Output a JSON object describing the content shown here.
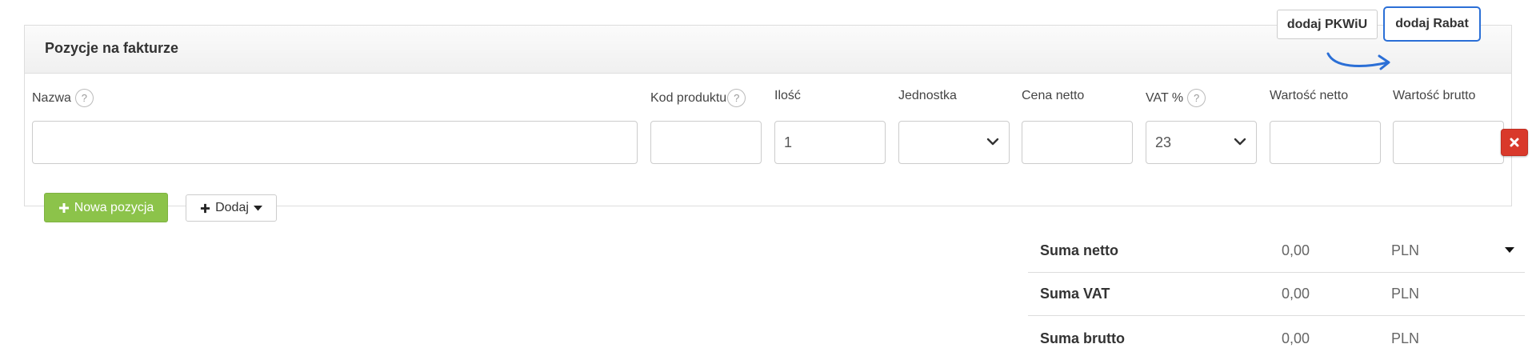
{
  "panel": {
    "title": "Pozycje na fakturze",
    "buttons": {
      "pkwiu": "dodaj PKWiU",
      "rabat": "dodaj Rabat"
    }
  },
  "columns": {
    "nazwa": "Nazwa",
    "kod": "Kod produktu",
    "ilosc": "Ilość",
    "jednostka": "Jednostka",
    "cena_netto": "Cena netto",
    "vat": "VAT %",
    "wartosc_netto": "Wartość netto",
    "wartosc_brutto": "Wartość brutto"
  },
  "help_glyph": "?",
  "row": {
    "nazwa": "",
    "kod": "",
    "ilosc": "1",
    "jednostka": "",
    "cena_netto": "",
    "vat": "23",
    "wartosc_netto": "",
    "wartosc_brutto": ""
  },
  "actions": {
    "nowa_pozycja": "Nowa pozycja",
    "dodaj": "Dodaj"
  },
  "summary": [
    {
      "label": "Suma netto",
      "value": "0,00",
      "currency": "PLN"
    },
    {
      "label": "Suma VAT",
      "value": "0,00",
      "currency": "PLN"
    },
    {
      "label": "Suma brutto",
      "value": "0,00",
      "currency": "PLN"
    }
  ],
  "colors": {
    "accent_green": "#8cc34a",
    "delete_red": "#d9392b",
    "highlight_blue": "#2b6fd6"
  },
  "icons": [
    "help-icon",
    "chevron-down-icon",
    "close-icon",
    "plus-icon",
    "caret-down-icon",
    "arrow-annotation-icon"
  ]
}
